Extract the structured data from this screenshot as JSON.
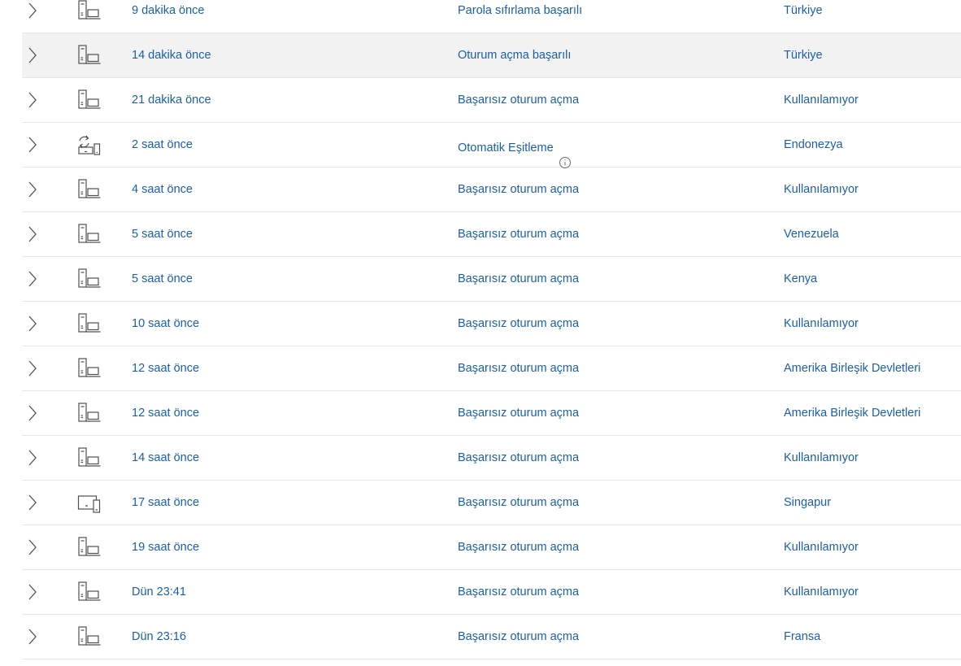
{
  "rows": [
    {
      "time": "9 dakika önce",
      "activity": "Parola sıfırlama başarılı",
      "location": "Türkiye",
      "device_icon": "computer-icon",
      "has_info": false,
      "selected": false
    },
    {
      "time": "14 dakika önce",
      "activity": "Oturum açma başarılı",
      "location": "Türkiye",
      "device_icon": "computer-icon",
      "has_info": false,
      "selected": true
    },
    {
      "time": "21 dakika önce",
      "activity": "Başarısız oturum açma",
      "location": "Kullanılamıyor",
      "device_icon": "computer-icon",
      "has_info": false,
      "selected": false
    },
    {
      "time": "2 saat önce",
      "activity": "Otomatik Eşitleme",
      "location": "Endonezya",
      "device_icon": "sync-devices-icon",
      "has_info": true,
      "selected": false
    },
    {
      "time": "4 saat önce",
      "activity": "Başarısız oturum açma",
      "location": "Kullanılamıyor",
      "device_icon": "computer-icon",
      "has_info": false,
      "selected": false
    },
    {
      "time": "5 saat önce",
      "activity": "Başarısız oturum açma",
      "location": "Venezuela",
      "device_icon": "computer-icon",
      "has_info": false,
      "selected": false
    },
    {
      "time": "5 saat önce",
      "activity": "Başarısız oturum açma",
      "location": "Kenya",
      "device_icon": "computer-icon",
      "has_info": false,
      "selected": false
    },
    {
      "time": "10 saat önce",
      "activity": "Başarısız oturum açma",
      "location": "Kullanılamıyor",
      "device_icon": "computer-icon",
      "has_info": false,
      "selected": false
    },
    {
      "time": "12 saat önce",
      "activity": "Başarısız oturum açma",
      "location": "Amerika Birleşik Devletleri",
      "device_icon": "computer-icon",
      "has_info": false,
      "selected": false
    },
    {
      "time": "12 saat önce",
      "activity": "Başarısız oturum açma",
      "location": "Amerika Birleşik Devletleri",
      "device_icon": "computer-icon",
      "has_info": false,
      "selected": false
    },
    {
      "time": "14 saat önce",
      "activity": "Başarısız oturum açma",
      "location": "Kullanılamıyor",
      "device_icon": "computer-icon",
      "has_info": false,
      "selected": false
    },
    {
      "time": "17 saat önce",
      "activity": "Başarısız oturum açma",
      "location": "Singapur",
      "device_icon": "tablet-phone-icon",
      "has_info": false,
      "selected": false
    },
    {
      "time": "19 saat önce",
      "activity": "Başarısız oturum açma",
      "location": "Kullanılamıyor",
      "device_icon": "computer-icon",
      "has_info": false,
      "selected": false
    },
    {
      "time": "Dün 23:41",
      "activity": "Başarısız oturum açma",
      "location": "Kullanılamıyor",
      "device_icon": "computer-icon",
      "has_info": false,
      "selected": false
    },
    {
      "time": "Dün 23:16",
      "activity": "Başarısız oturum açma",
      "location": "Fransa",
      "device_icon": "computer-icon",
      "has_info": false,
      "selected": false
    }
  ],
  "colors": {
    "link_text": "#1a5fa8",
    "icon_stroke": "#505050",
    "selected_row_bg": "#f2f2f2",
    "row_divider": "#e6e6e6"
  }
}
